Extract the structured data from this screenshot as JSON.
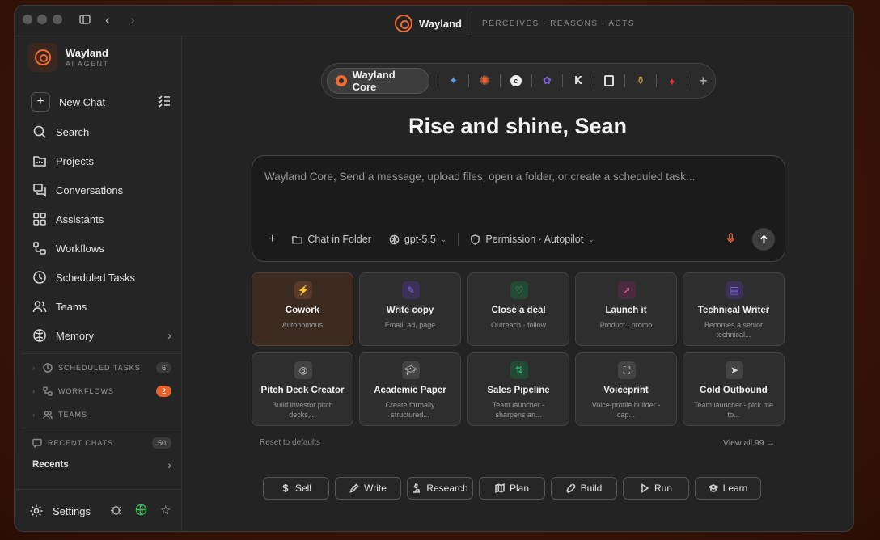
{
  "app": {
    "name": "Wayland",
    "tagline": "PERCEIVES · REASONS · ACTS",
    "subtitle": "AI AGENT"
  },
  "sidebar": {
    "new_chat": "New Chat",
    "items": [
      {
        "label": "Search",
        "icon": "search-icon"
      },
      {
        "label": "Projects",
        "icon": "folder-icon"
      },
      {
        "label": "Conversations",
        "icon": "chat-icon"
      },
      {
        "label": "Assistants",
        "icon": "grid-icon"
      },
      {
        "label": "Workflows",
        "icon": "workflow-icon"
      },
      {
        "label": "Scheduled Tasks",
        "icon": "clock-icon"
      },
      {
        "label": "Teams",
        "icon": "users-icon"
      },
      {
        "label": "Memory",
        "icon": "brain-icon"
      }
    ],
    "sections": [
      {
        "label": "SCHEDULED TASKS",
        "count": "6"
      },
      {
        "label": "WORKFLOWS",
        "count": "2"
      },
      {
        "label": "TEAMS",
        "count": ""
      }
    ],
    "recent_chats": {
      "label": "RECENT CHATS",
      "count": "50"
    },
    "recents": "Recents",
    "settings": "Settings"
  },
  "model_bar": {
    "active": "Wayland Core"
  },
  "greeting": "Rise and shine, Sean",
  "composer": {
    "placeholder": "Wayland Core, Send a message, upload files, open a folder, or create a scheduled task...",
    "chat_in_folder": "Chat in Folder",
    "model": "gpt-5.5",
    "permission": "Permission · Autopilot"
  },
  "cards": [
    {
      "title": "Cowork",
      "sub": "Autonomous",
      "color": "#e8622e"
    },
    {
      "title": "Write copy",
      "sub": "Email, ad, page",
      "color": "#8b6cf0"
    },
    {
      "title": "Close a deal",
      "sub": "Outreach · follow",
      "color": "#3fbf7a"
    },
    {
      "title": "Launch it",
      "sub": "Product · promo",
      "color": "#e45aa0"
    },
    {
      "title": "Technical Writer",
      "sub": "Becomes a senior technical...",
      "color": "#8b6cf0"
    },
    {
      "title": "Pitch Deck Creator",
      "sub": "Build investor pitch decks,...",
      "color": "#cfcfcf"
    },
    {
      "title": "Academic Paper",
      "sub": "Create formally structured...",
      "color": "#cfcfcf"
    },
    {
      "title": "Sales Pipeline",
      "sub": "Team launcher - sharpens an...",
      "color": "#3fbf7a"
    },
    {
      "title": "Voiceprint",
      "sub": "Voice-profile builder - cap...",
      "color": "#cfcfcf"
    },
    {
      "title": "Cold Outbound",
      "sub": "Team launcher - pick me to...",
      "color": "#cfcfcf"
    }
  ],
  "reset_label": "Reset to defaults",
  "view_all_label": "View all 99 →",
  "chips": [
    "Sell",
    "Write",
    "Research",
    "Plan",
    "Build",
    "Run",
    "Learn"
  ]
}
